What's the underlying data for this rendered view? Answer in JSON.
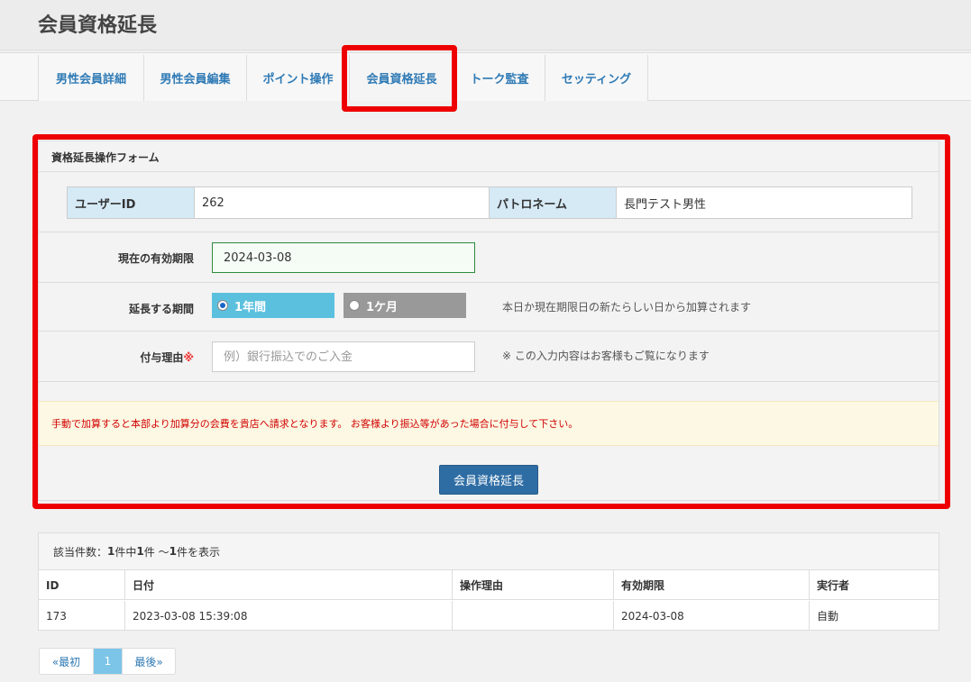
{
  "header": {
    "title": "会員資格延長"
  },
  "tabs": [
    {
      "label": "男性会員詳細"
    },
    {
      "label": "男性会員編集"
    },
    {
      "label": "ポイント操作"
    },
    {
      "label": "会員資格延長"
    },
    {
      "label": "トーク監査"
    },
    {
      "label": "セッティング"
    }
  ],
  "form": {
    "title": "資格延長操作フォーム",
    "user_id_label": "ユーザーID",
    "user_id_value": "262",
    "patron_name_label": "パトロネーム",
    "patron_name_value": "長門テスト男性",
    "current_expiry_label": "現在の有効期限",
    "current_expiry_value": "2024-03-08",
    "extend_period_label": "延長する期間",
    "option_year": "1年間",
    "option_month": "1ケ月",
    "selected_option": "1年間",
    "extend_hint": "本日か現在期限日の新たらしい日から加算されます",
    "reason_label": "付与理由",
    "required_mark": "※",
    "reason_placeholder": "例）銀行振込でのご入金",
    "reason_hint": "※ この入力内容はお客様もご覧になります",
    "notice": "手動で加算すると本部より加算分の会費を貴店へ請求となります。 お客様より振込等があった場合に付与して下さい。",
    "submit_label": "会員資格延長"
  },
  "results": {
    "count_prefix": "該当件数：",
    "count_total": "1",
    "count_mid1": "件中 ",
    "count_from": "1",
    "count_mid2": "件 ～ ",
    "count_to": "1",
    "count_suffix": "件を表示",
    "columns": [
      "ID",
      "日付",
      "操作理由",
      "有効期限",
      "実行者"
    ],
    "rows": [
      {
        "id": "173",
        "date": "2023-03-08 15:39:08",
        "reason": "",
        "expiry": "2024-03-08",
        "executor": "自動"
      }
    ]
  },
  "pagination": {
    "first": "«最初",
    "current": "1",
    "last": "最後»"
  },
  "colors": {
    "highlight": "#ee0000",
    "tab_text": "#2f7ab5",
    "primary_button": "#2e6da4",
    "radio_selected": "#5bc0de",
    "notice_text": "#d10000"
  }
}
